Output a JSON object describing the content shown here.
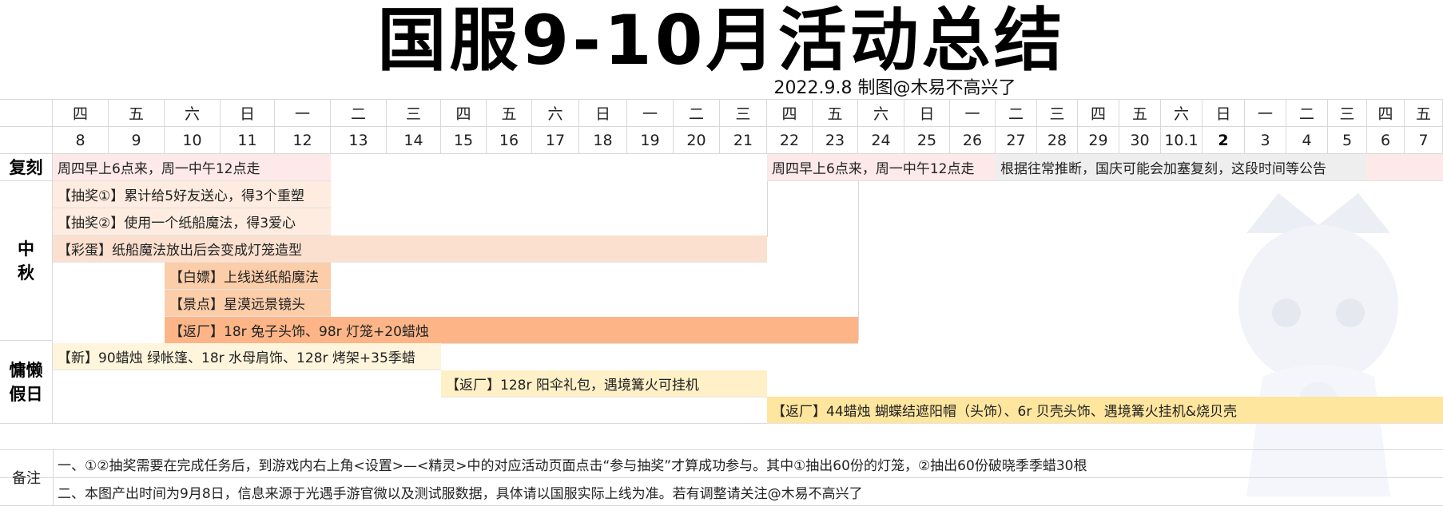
{
  "title": "国服9-10月活动总结",
  "subtitle": "2022.9.8   制图@木易不高兴了",
  "days": [
    {
      "weekday": "四",
      "date": "8"
    },
    {
      "weekday": "五",
      "date": "9"
    },
    {
      "weekday": "六",
      "date": "10"
    },
    {
      "weekday": "日",
      "date": "11"
    },
    {
      "weekday": "一",
      "date": "12"
    },
    {
      "weekday": "二",
      "date": "13"
    },
    {
      "weekday": "三",
      "date": "14"
    },
    {
      "weekday": "四",
      "date": "15"
    },
    {
      "weekday": "五",
      "date": "16"
    },
    {
      "weekday": "六",
      "date": "17"
    },
    {
      "weekday": "日",
      "date": "18"
    },
    {
      "weekday": "一",
      "date": "19"
    },
    {
      "weekday": "二",
      "date": "20"
    },
    {
      "weekday": "三",
      "date": "21"
    },
    {
      "weekday": "四",
      "date": "22"
    },
    {
      "weekday": "五",
      "date": "23"
    },
    {
      "weekday": "六",
      "date": "24"
    },
    {
      "weekday": "日",
      "date": "25"
    },
    {
      "weekday": "一",
      "date": "26"
    },
    {
      "weekday": "二",
      "date": "27"
    },
    {
      "weekday": "三",
      "date": "28"
    },
    {
      "weekday": "四",
      "date": "29"
    },
    {
      "weekday": "五",
      "date": "30"
    },
    {
      "weekday": "六",
      "date": "10.1"
    },
    {
      "weekday": "日",
      "date": "2"
    },
    {
      "weekday": "一",
      "date": "3"
    },
    {
      "weekday": "二",
      "date": "4"
    },
    {
      "weekday": "三",
      "date": "5"
    },
    {
      "weekday": "四",
      "date": "6"
    },
    {
      "weekday": "五",
      "date": "7"
    }
  ],
  "sections": {
    "rerun": "复刻",
    "mid_autumn": "中\n秋",
    "lazy_days": "慵懒\n假日",
    "notes": "备注"
  },
  "events": {
    "rerun_1": "周四早上6点来，周一中午12点走",
    "rerun_2": "周四早上6点来，周一中午12点走",
    "rerun_3": "根据往常推断，国庆可能会加塞复刻，这段时间等公告",
    "ma_1": "【抽奖①】累计给5好友送心，得3个重塑",
    "ma_2": "【抽奖②】使用一个纸船魔法，得3爱心",
    "ma_3": "【彩蛋】纸船魔法放出后会变成灯笼造型",
    "ma_4": "【白嫖】上线送纸船魔法",
    "ma_5": "【景点】星漠远景镜头",
    "ma_6": "【返厂】18r 兔子头饰、98r 灯笼+20蜡烛",
    "lazy_1": "【新】90蜡烛 绿帐篷、18r 水母肩饰、128r 烤架+35季蜡",
    "lazy_2": "【返厂】128r 阳伞礼包，遇境篝火可挂机",
    "lazy_3": "【返厂】44蜡烛 蝴蝶结遮阳帽（头饰）、6r 贝壳头饰、遇境篝火挂机&烧贝壳"
  },
  "notes": [
    "一、①②抽奖需要在完成任务后，到游戏内右上角<设置>—<精灵>中的对应活动页面点击“参与抽奖”才算成功参与。其中①抽出60份的灯笼，②抽出60份破晓季季蜡30根",
    "二、本图产出时间为9月8日，信息来源于光遇手游官微以及测试服数据，具体请以国服实际上线为准。若有调整请关注@木易不高兴了"
  ],
  "colors": {
    "pink": "#fde9e9",
    "peach": "#fbe0cf",
    "orange": "#fdb587",
    "yellow": "#ffe69e"
  }
}
